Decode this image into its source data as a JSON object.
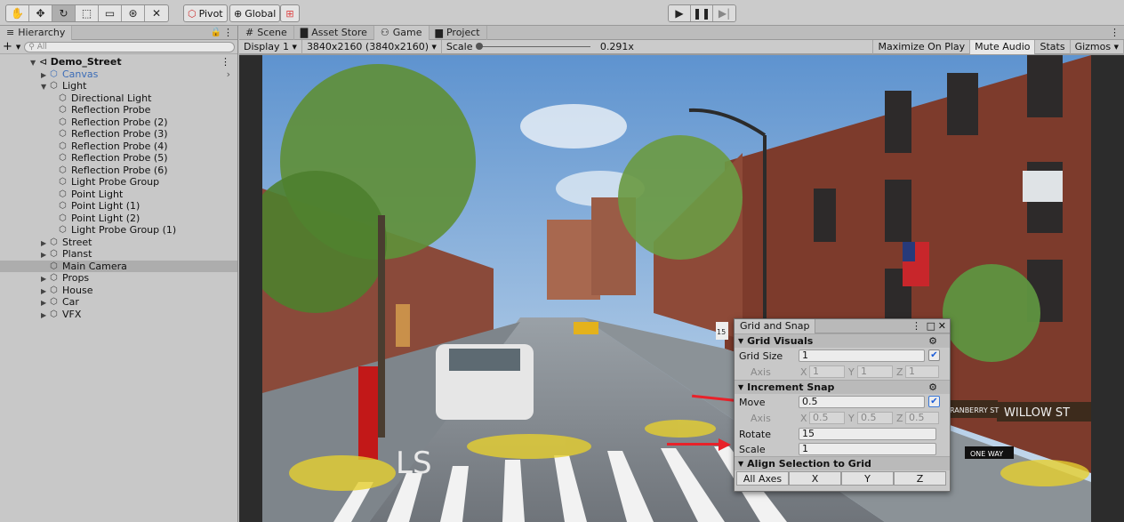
{
  "toolbar": {
    "tools": [
      "hand-icon",
      "move-icon",
      "rotate-icon",
      "rect-icon",
      "scale-icon",
      "transform-icon",
      "custom-tool-icon"
    ],
    "pivot": "Pivot",
    "global": "Global",
    "play_buttons": [
      "play-icon",
      "pause-icon",
      "step-icon"
    ]
  },
  "hierarchy": {
    "tab": "Hierarchy",
    "add": "+",
    "search_placeholder": "All",
    "scene": "Demo_Street",
    "items": [
      {
        "label": "Canvas",
        "depth": 1,
        "arrow": "▶",
        "color": "#3b6cb7"
      },
      {
        "label": "Light",
        "depth": 1,
        "arrow": "▼"
      },
      {
        "label": "Directional Light",
        "depth": 2
      },
      {
        "label": "Reflection Probe",
        "depth": 2
      },
      {
        "label": "Reflection Probe (2)",
        "depth": 2
      },
      {
        "label": "Reflection Probe (3)",
        "depth": 2
      },
      {
        "label": "Reflection Probe (4)",
        "depth": 2
      },
      {
        "label": "Reflection Probe (5)",
        "depth": 2
      },
      {
        "label": "Reflection Probe (6)",
        "depth": 2
      },
      {
        "label": "Light Probe Group",
        "depth": 2
      },
      {
        "label": "Point Light",
        "depth": 2
      },
      {
        "label": "Point Light (1)",
        "depth": 2
      },
      {
        "label": "Point Light (2)",
        "depth": 2
      },
      {
        "label": "Light Probe Group (1)",
        "depth": 2
      },
      {
        "label": "Street",
        "depth": 1,
        "arrow": "▶"
      },
      {
        "label": "Planst",
        "depth": 1,
        "arrow": "▶"
      },
      {
        "label": "Main Camera",
        "depth": 1,
        "selected": true
      },
      {
        "label": "Props",
        "depth": 1,
        "arrow": "▶"
      },
      {
        "label": "House",
        "depth": 1,
        "arrow": "▶"
      },
      {
        "label": "Car",
        "depth": 1,
        "arrow": "▶"
      },
      {
        "label": "VFX",
        "depth": 1,
        "arrow": "▶"
      }
    ]
  },
  "view_tabs": [
    "Scene",
    "Asset Store",
    "Game",
    "Project"
  ],
  "gamebar": {
    "display": "Display 1",
    "resolution": "3840x2160 (3840x2160)",
    "scale_label": "Scale",
    "scale_value": "0.291x",
    "maximize": "Maximize On Play",
    "mute": "Mute Audio",
    "stats": "Stats",
    "gizmos": "Gizmos"
  },
  "grid_snap": {
    "title": "Grid and Snap",
    "grid_visuals": "Grid Visuals",
    "grid_size_label": "Grid Size",
    "grid_size": "1",
    "axis_label": "Axis",
    "grid_axis": {
      "x": "1",
      "y": "1",
      "z": "1"
    },
    "increment_snap": "Increment Snap",
    "move_label": "Move",
    "move": "0.5",
    "move_axis": {
      "x": "0.5",
      "y": "0.5",
      "z": "0.5"
    },
    "rotate_label": "Rotate",
    "rotate": "15",
    "scale_label": "Scale",
    "scale": "1",
    "align_header": "Align Selection to Grid",
    "align_buttons": [
      "All Axes",
      "X",
      "Y",
      "Z"
    ]
  },
  "scene_signs": {
    "street": "WILLOW ST",
    "street2": "RANBERRY ST",
    "one_way": "ONE WAY",
    "sign_num": "15"
  }
}
